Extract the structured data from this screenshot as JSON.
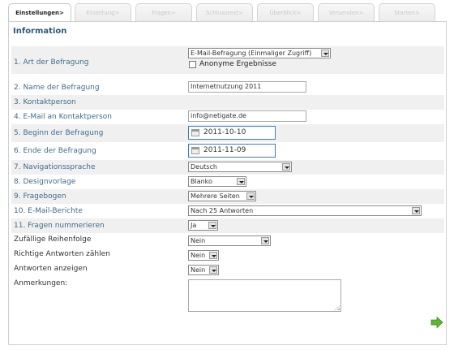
{
  "tabs": [
    {
      "label": "Einstellungen>",
      "active": true
    },
    {
      "label": "Einleitung>",
      "active": false
    },
    {
      "label": "Fragen>",
      "active": false
    },
    {
      "label": "Schlusstext>",
      "active": false
    },
    {
      "label": "Überblick>",
      "active": false
    },
    {
      "label": "Versenden>",
      "active": false
    },
    {
      "label": "Starten>",
      "active": false
    }
  ],
  "section_title": "Information",
  "fields": {
    "art": {
      "label": "1. Art der Befragung",
      "value": "E-Mail-Befragung (Einmaliger Zugriff)",
      "checkbox_label": "Anonyme Ergebnisse",
      "checked": false
    },
    "name": {
      "label": "2. Name der Befragung",
      "value": "Internetnutzung 2011"
    },
    "kontakt": {
      "label": "3. Kontaktperson"
    },
    "email": {
      "label": "4. E-Mail an Kontaktperson",
      "value": "info@netigate.de"
    },
    "beginn": {
      "label": "5. Beginn der Befragung",
      "value": "2011-10-10"
    },
    "ende": {
      "label": "6. Ende der Befragung",
      "value": "2011-11-09"
    },
    "navsprache": {
      "label": "7. Navigationssprache",
      "value": "Deutsch"
    },
    "design": {
      "label": "8. Designvorlage",
      "value": "Blanko"
    },
    "fragebogen": {
      "label": "9. Fragebogen",
      "value": "Mehrere Seiten"
    },
    "berichte": {
      "label": "10. E-Mail-Berichte",
      "value": "Nach 25 Antworten"
    },
    "nummerieren": {
      "label": "11. Fragen nummerieren",
      "value": "Ja"
    },
    "reihenfolge": {
      "label": "Zufällige Reihenfolge",
      "value": "Nein"
    },
    "richtige": {
      "label": "Richtige Antworten zählen",
      "value": "Nein"
    },
    "anzeigen": {
      "label": "Antworten anzeigen",
      "value": "Nein"
    },
    "anmerkungen": {
      "label": "Anmerkungen:",
      "value": ""
    }
  },
  "colors": {
    "label": "#3d6d8c",
    "title": "#2a5a7a",
    "next_arrow": "#5cb531"
  },
  "icons": {
    "next": "right-arrow-icon",
    "calendar": "calendar-icon"
  }
}
